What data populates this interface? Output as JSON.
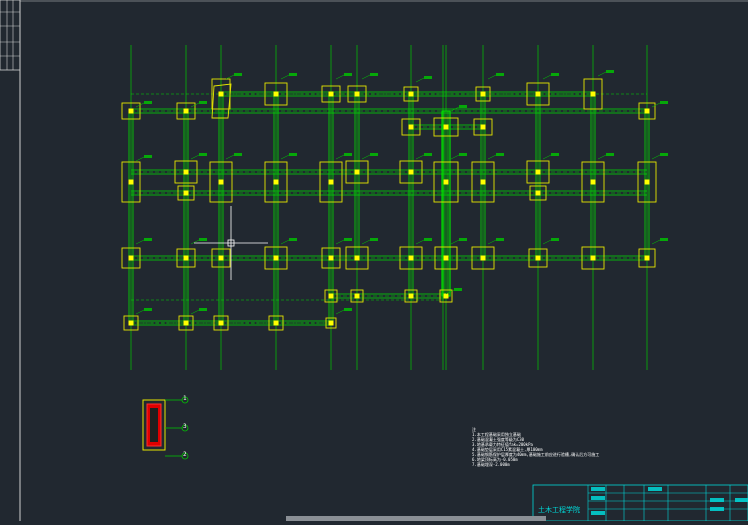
{
  "drawing": {
    "notes_title": "注",
    "notes": [
      "1.本工程基础采用独立基础",
      "2.基础混凝土强度等级为C30",
      "3.地基承载力特征值fak=200kPa",
      "4.基础垫层采用C15素混凝土,厚100mm",
      "5.基础钢筋保护层厚度为40mm,基础施工前应进行验槽,确认后方可施工",
      "6.地梁顶标高为-0.050m",
      "7.基础埋深-2.000m"
    ],
    "callouts": [
      "1",
      "3",
      "2"
    ],
    "title_block_label": "土木工程学院"
  },
  "colors": {
    "background": "#212830",
    "axis": "#00c800",
    "beam": "#00e000",
    "footing": "#e6e600",
    "column": "#ffff00",
    "text": "#ffffff",
    "title_block": "#00d8d8",
    "frame": "#d0d0d0"
  }
}
